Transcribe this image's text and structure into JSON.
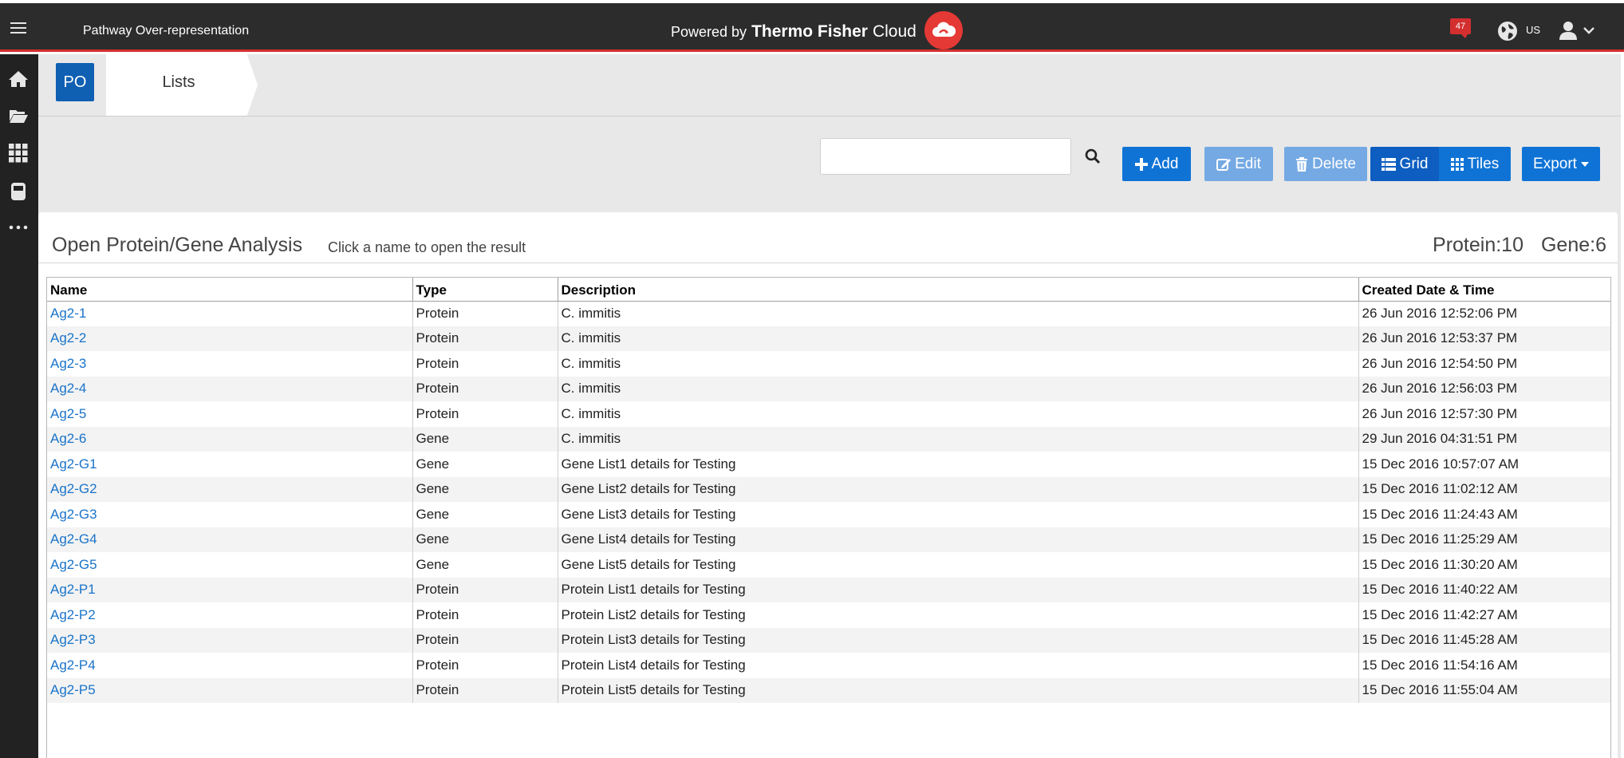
{
  "header": {
    "app_title": "Pathway Over-representation",
    "brand_prefix": "Powered by",
    "brand_name": "Thermo Fisher",
    "brand_suffix": "Cloud",
    "notification_count": "47",
    "language": "US"
  },
  "leftnav": {
    "items": [
      "home-icon",
      "folder-open-icon",
      "apps-grid-icon",
      "storage-icon",
      "more-icon"
    ]
  },
  "breadcrumb": {
    "badge": "PO",
    "current": "Lists"
  },
  "toolbar": {
    "search_value": "",
    "add_label": "Add",
    "edit_label": "Edit",
    "delete_label": "Delete",
    "grid_label": "Grid",
    "tiles_label": "Tiles",
    "export_label": "Export"
  },
  "panel": {
    "title": "Open Protein/Gene Analysis",
    "hint": "Click a name to open the result",
    "protein_count": "Protein:10",
    "gene_count": "Gene:6"
  },
  "table": {
    "columns": [
      "Name",
      "Type",
      "Description",
      "Created Date & Time"
    ],
    "rows": [
      [
        "Ag2-1",
        "Protein",
        "C. immitis",
        "26 Jun 2016 12:52:06 PM"
      ],
      [
        "Ag2-2",
        "Protein",
        "C. immitis",
        "26 Jun 2016 12:53:37 PM"
      ],
      [
        "Ag2-3",
        "Protein",
        "C. immitis",
        "26 Jun 2016 12:54:50 PM"
      ],
      [
        "Ag2-4",
        "Protein",
        "C. immitis",
        "26 Jun 2016 12:56:03 PM"
      ],
      [
        "Ag2-5",
        "Protein",
        "C. immitis",
        "26 Jun 2016 12:57:30 PM"
      ],
      [
        "Ag2-6",
        "Gene",
        "C. immitis",
        "29 Jun 2016 04:31:51 PM"
      ],
      [
        "Ag2-G1",
        "Gene",
        "Gene List1 details for Testing",
        "15 Dec 2016 10:57:07 AM"
      ],
      [
        "Ag2-G2",
        "Gene",
        "Gene List2 details for Testing",
        "15 Dec 2016 11:02:12 AM"
      ],
      [
        "Ag2-G3",
        "Gene",
        "Gene List3 details for Testing",
        "15 Dec 2016 11:24:43 AM"
      ],
      [
        "Ag2-G4",
        "Gene",
        "Gene List4 details for Testing",
        "15 Dec 2016 11:25:29 AM"
      ],
      [
        "Ag2-G5",
        "Gene",
        "Gene List5 details for Testing",
        "15 Dec 2016 11:30:20 AM"
      ],
      [
        "Ag2-P1",
        "Protein",
        "Protein List1 details for Testing",
        "15 Dec 2016 11:40:22 AM"
      ],
      [
        "Ag2-P2",
        "Protein",
        "Protein List2 details for Testing",
        "15 Dec 2016 11:42:27 AM"
      ],
      [
        "Ag2-P3",
        "Protein",
        "Protein List3 details for Testing",
        "15 Dec 2016 11:45:28 AM"
      ],
      [
        "Ag2-P4",
        "Protein",
        "Protein List4 details for Testing",
        "15 Dec 2016 11:54:16 AM"
      ],
      [
        "Ag2-P5",
        "Protein",
        "Protein List5 details for Testing",
        "15 Dec 2016 11:55:04 AM"
      ]
    ]
  },
  "colors": {
    "topbar": "#2c2c2c",
    "accent_red": "#d32f2f",
    "primary_blue": "#0f73d6",
    "link_blue": "#1a73c8"
  }
}
